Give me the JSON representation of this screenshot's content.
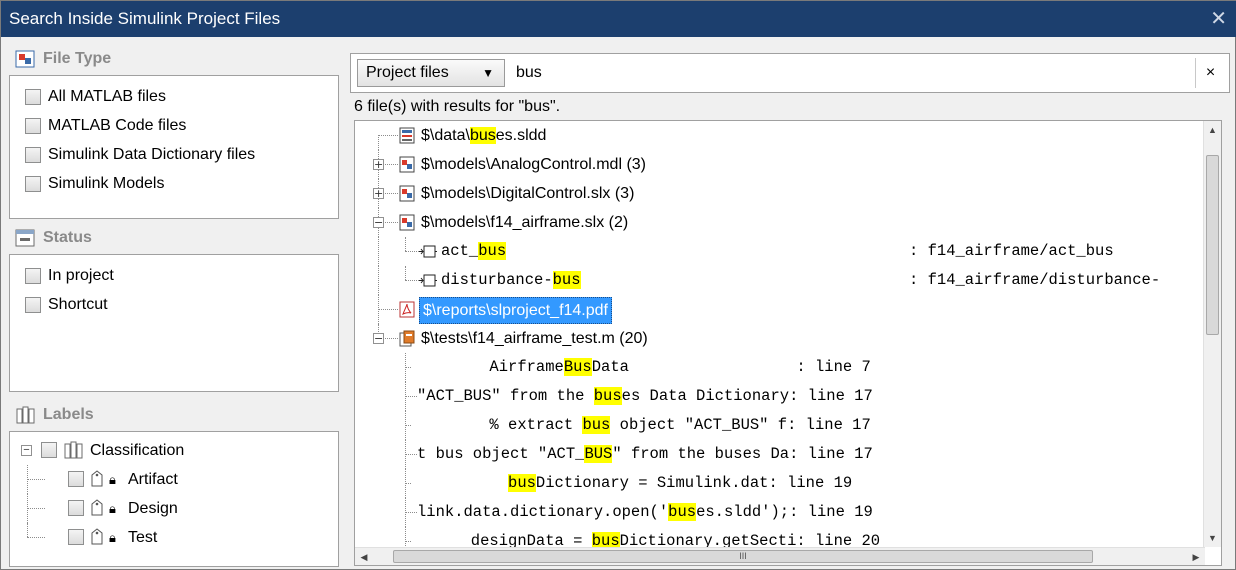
{
  "window": {
    "title": "Search Inside Simulink Project Files",
    "close_glyph": "✕"
  },
  "file_type": {
    "header": "File Type",
    "options": [
      "All MATLAB files",
      "MATLAB Code files",
      "Simulink Data Dictionary files",
      "Simulink Models"
    ]
  },
  "status": {
    "header": "Status",
    "options": [
      "In project",
      "Shortcut"
    ]
  },
  "labels": {
    "header": "Labels",
    "category": "Classification",
    "items": [
      "Artifact",
      "Design",
      "Test"
    ]
  },
  "search": {
    "scope": "Project files",
    "query": "bus",
    "clear_glyph": "×",
    "summary": "6 file(s) with results for \"bus\"."
  },
  "results": [
    {
      "pre": "$\\data\\",
      "hl": "bus",
      "post": "es.sldd"
    },
    {
      "text": "$\\models\\AnalogControl.mdl (3)"
    },
    {
      "text": "$\\models\\DigitalControl.slx (3)"
    },
    {
      "text": "$\\models\\f14_airframe.slx (2)"
    },
    {
      "pre": "act_",
      "hl": "bus",
      "post": "",
      "path": ": f14_airframe/act_bus"
    },
    {
      "pre": "disturbance-",
      "hl": "bus",
      "post": "",
      "path": ": f14_airframe/disturbance-"
    },
    {
      "text": "$\\reports\\slproject_f14.pdf"
    },
    {
      "text": "$\\tests\\f14_airframe_test.m (20)"
    },
    {
      "pre": "        Airframe",
      "hl": "Bus",
      "post": "Data                  : line 7"
    },
    {
      "pre": "\"ACT_BUS\" from the ",
      "hl": "bus",
      "post": "es Data Dictionary: line 17"
    },
    {
      "pre": "        % extract ",
      "hl": "bus",
      "post": " object \"ACT_BUS\" f: line 17"
    },
    {
      "pre": "t bus object \"ACT_",
      "hl": "BUS",
      "post": "\" from the buses Da: line 17"
    },
    {
      "pre": "          ",
      "hl": "bus",
      "post": "Dictionary = Simulink.dat: line 19"
    },
    {
      "pre": "link.data.dictionary.open('",
      "hl": "bus",
      "post": "es.sldd');: line 19"
    },
    {
      "pre": "      designData = ",
      "hl": "bus",
      "post": "Dictionary.getSecti: line 20"
    }
  ],
  "scroll": {
    "thumb_glyph": "III"
  },
  "icons": {
    "file_type": "filter-icon",
    "status": "status-icon",
    "labels": "labels-icon",
    "model": "simulink-model-icon",
    "dictionary": "data-dictionary-icon",
    "pdf": "pdf-icon",
    "test": "test-file-icon",
    "block": "block-icon",
    "tag": "tag-icon",
    "lock": "lock-icon"
  },
  "colors": {
    "titlebar": "#1c3f6e",
    "highlight": "#ffff00",
    "selection": "#3399ff"
  }
}
